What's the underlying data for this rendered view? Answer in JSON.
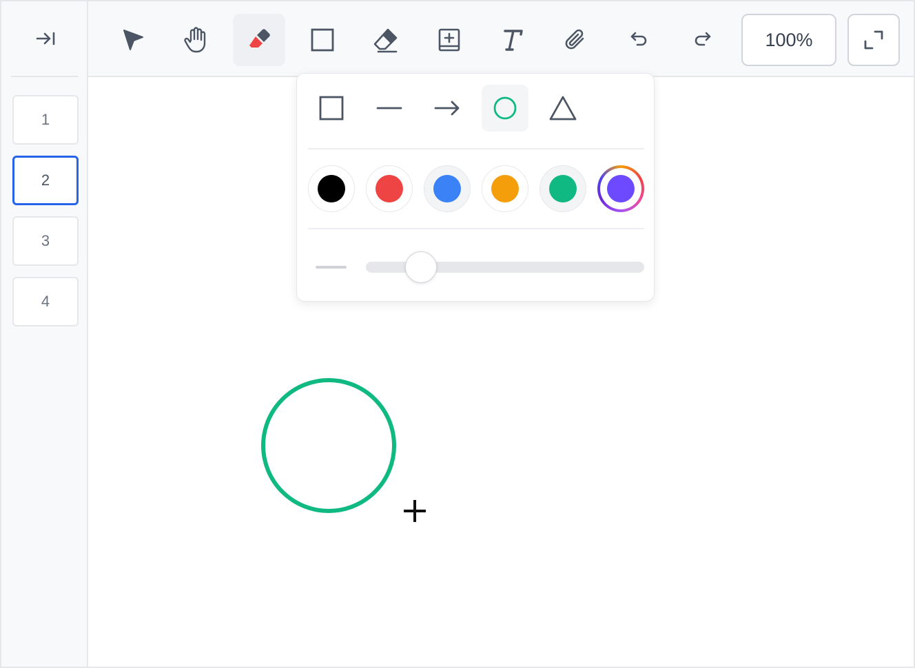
{
  "sidebar": {
    "collapse_icon": "collapse-right-icon",
    "pages": [
      {
        "label": "1",
        "active": false
      },
      {
        "label": "2",
        "active": true
      },
      {
        "label": "3",
        "active": false
      },
      {
        "label": "4",
        "active": false
      }
    ]
  },
  "toolbar": {
    "tools": [
      {
        "name": "select",
        "icon": "cursor-arrow-icon",
        "active": false
      },
      {
        "name": "pan",
        "icon": "hand-icon",
        "active": false
      },
      {
        "name": "pen",
        "icon": "marker-icon",
        "active": true
      },
      {
        "name": "shape",
        "icon": "square-icon",
        "active": false
      },
      {
        "name": "eraser",
        "icon": "eraser-icon",
        "active": false
      },
      {
        "name": "add-frame",
        "icon": "add-frame-icon",
        "active": false
      },
      {
        "name": "text",
        "icon": "text-icon",
        "active": false
      },
      {
        "name": "attach",
        "icon": "paperclip-icon",
        "active": false
      },
      {
        "name": "undo",
        "icon": "undo-icon",
        "active": false
      },
      {
        "name": "redo",
        "icon": "redo-icon",
        "active": false
      }
    ],
    "zoom_label": "100%",
    "fullscreen_icon": "fullscreen-icon"
  },
  "shape_popover": {
    "shapes": [
      {
        "name": "rectangle",
        "icon": "rectangle-icon",
        "active": false
      },
      {
        "name": "line",
        "icon": "line-icon",
        "active": false
      },
      {
        "name": "arrow",
        "icon": "arrow-right-icon",
        "active": false
      },
      {
        "name": "ellipse",
        "icon": "circle-icon",
        "active": true
      },
      {
        "name": "triangle",
        "icon": "triangle-icon",
        "active": false
      }
    ],
    "colors": [
      {
        "name": "black",
        "hex": "#000000"
      },
      {
        "name": "red",
        "hex": "#ef4444"
      },
      {
        "name": "blue",
        "hex": "#3b82f6"
      },
      {
        "name": "orange",
        "hex": "#f59e0b"
      },
      {
        "name": "green",
        "hex": "#10b981"
      },
      {
        "name": "custom",
        "hex": "#6d4aff"
      }
    ],
    "selected_color": "green",
    "stroke_width_fraction": 0.16
  },
  "canvas": {
    "drawn_shape": {
      "type": "ellipse",
      "stroke_color": "#10b981"
    },
    "cursor_icon": "crosshair-icon"
  },
  "colors": {
    "accent": "#2563eb",
    "icon": "#4b5563",
    "pen_tip": "#ef4444"
  }
}
